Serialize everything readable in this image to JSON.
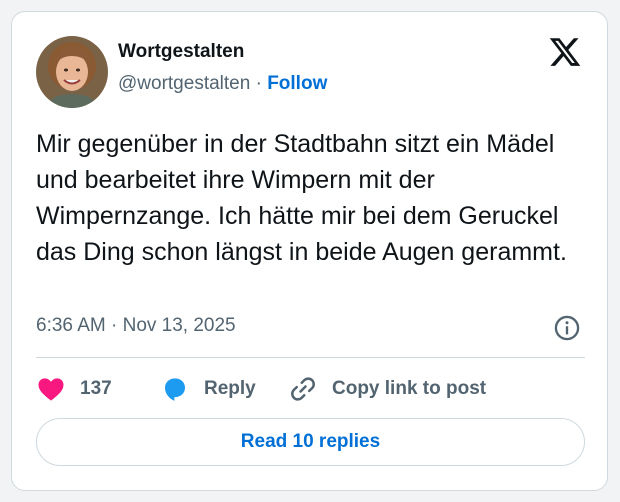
{
  "author": {
    "display_name": "Wortgestalten",
    "handle": "@wortgestalten",
    "separator": " · ",
    "follow_label": "Follow",
    "avatar_icon": "user-avatar"
  },
  "platform_icon": "x-logo-icon",
  "tweet": {
    "text": "Mir gegenüber in der Stadtbahn sitzt ein Mädel und bearbeitet ihre Wimpern mit der Wimpernzange. Ich hätte mir bei dem Geruckel das Ding schon längst in beide Augen gerammt.",
    "timestamp": "6:36 AM · Nov 13, 2025"
  },
  "actions": {
    "like_count": "137",
    "reply_label": "Reply",
    "copy_label": "Copy link to post"
  },
  "read_replies_label": "Read 10 replies",
  "colors": {
    "like": "#f91880",
    "reply": "#1d9bf0",
    "link": "#006fd6",
    "muted": "#536471",
    "border": "#cfd9de"
  }
}
